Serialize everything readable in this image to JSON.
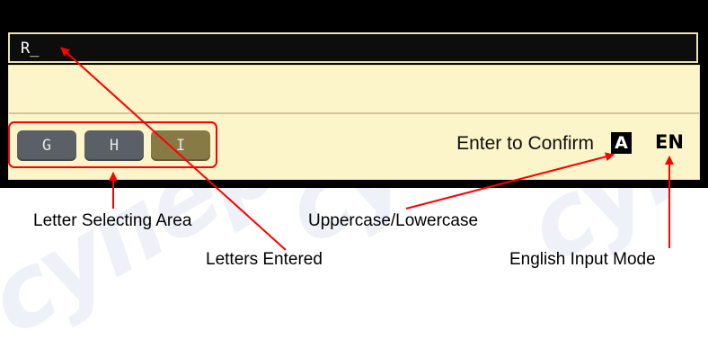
{
  "watermark": "суперайс",
  "entry": {
    "text": "R_"
  },
  "keys": [
    {
      "label": "G"
    },
    {
      "label": "H"
    },
    {
      "label": "I"
    }
  ],
  "status": {
    "confirm_label": "Enter to Confirm",
    "case_indicator": "A",
    "mode_indicator": "EN"
  },
  "callouts": {
    "letter_selecting_area": "Letter Selecting Area",
    "uppercase_lowercase": "Uppercase/Lowercase",
    "letters_entered": "Letters Entered",
    "english_input_mode": "English Input Mode"
  },
  "colors": {
    "panel_background": "#000000",
    "input_area": "#fbf5c9",
    "key_gray": "#5a6065",
    "key_selected": "#877a45",
    "callout_arrow": "#ff0000"
  }
}
